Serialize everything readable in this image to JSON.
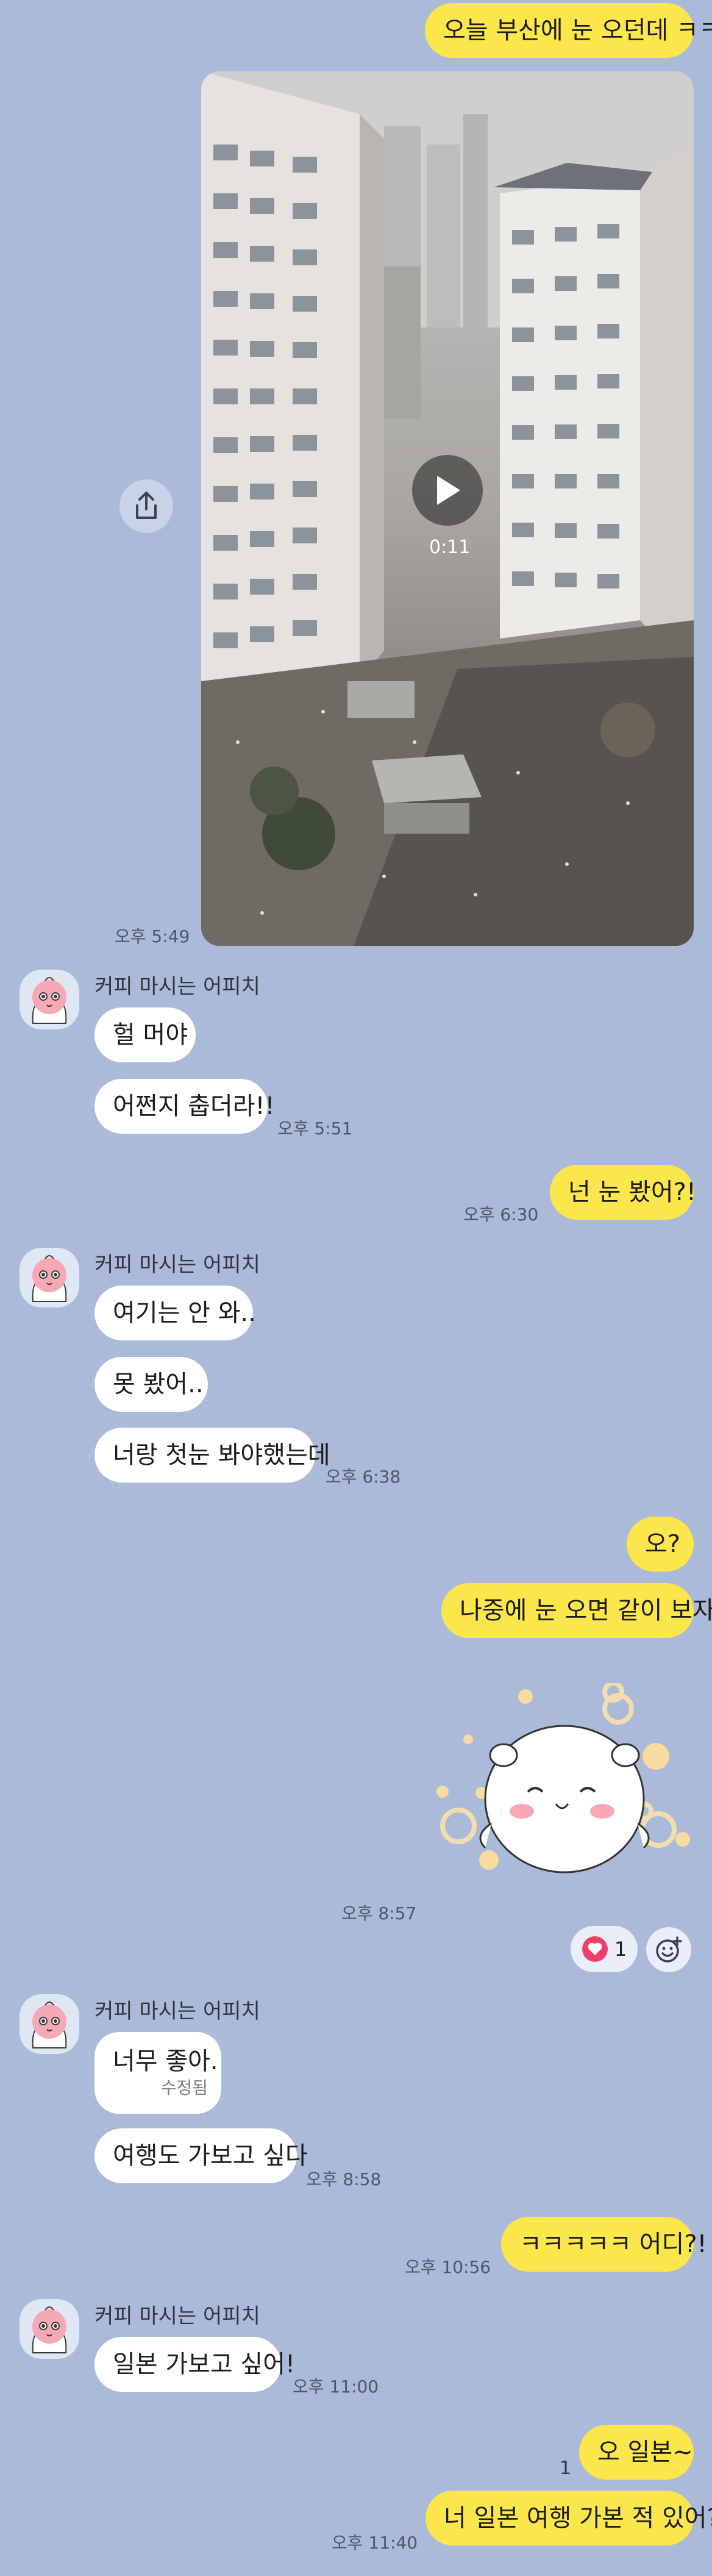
{
  "messages": {
    "m1": "오늘 부산에 눈 오던데 ㅋㅋ",
    "m1_video_duration": "0:11",
    "m1_time": "오후 5:49",
    "sender_name": "커피 마시는 어피치",
    "m2": "헐 머야",
    "m3": "어쩐지 춥더라!!",
    "m3_time": "오후 5:51",
    "m4": "넌 눈 봤어?!",
    "m4_time": "오후 6:30",
    "m5": "여기는 안 와..",
    "m6": "못 봤어..",
    "m7": "너랑 첫눈 봐야했는데",
    "m7_time": "오후 6:38",
    "m8": "오?",
    "m9": "나중에 눈 오면 같이 보자",
    "m10_time": "오후 8:57",
    "reaction_count": "1",
    "m11": "너무 좋아.",
    "m11_edited": "수정됨",
    "m12": "여행도 가보고 싶다",
    "m12_time": "오후 8:58",
    "m13": "ㅋㅋㅋㅋㅋ 어디?!",
    "m13_time": "오후 10:56",
    "m14": "일본 가보고 싶어!",
    "m14_time": "오후 11:00",
    "m15": "오 일본~",
    "m15_unread": "1",
    "m16": "너 일본 여행 가본 적 있어?",
    "m16_time": "오후 11:40"
  },
  "icons": {
    "share": "share-icon",
    "play": "play-icon",
    "heart": "heart-icon",
    "add_reaction": "add-reaction-icon",
    "avatar": "peach-avatar-icon",
    "sticker": "white-bear-sticker"
  },
  "colors": {
    "background": "#abbad8",
    "my_bubble": "#fbe74b",
    "their_bubble": "#ffffff",
    "heart": "#f0406a"
  }
}
